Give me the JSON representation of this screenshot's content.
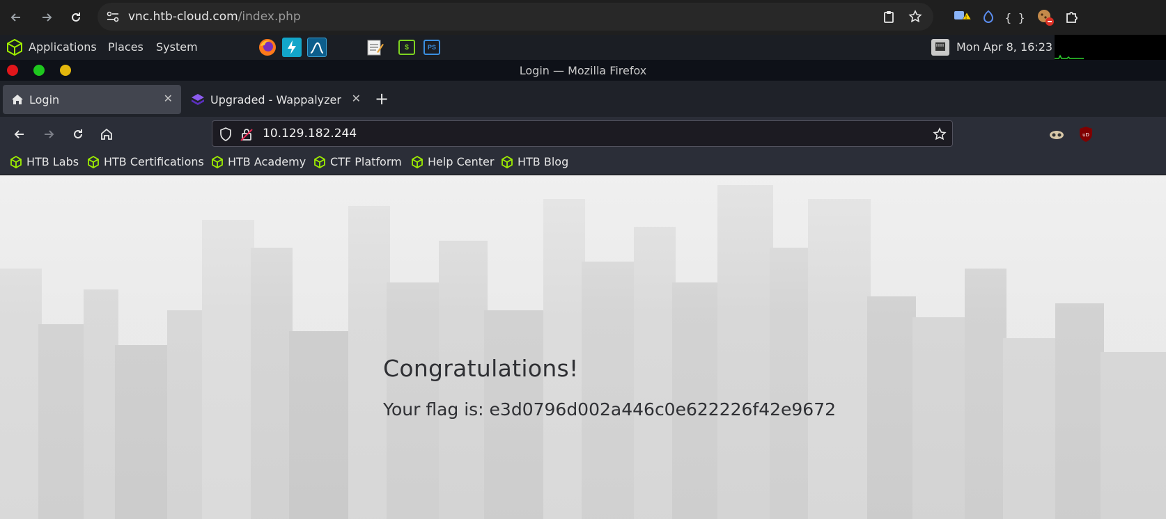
{
  "chrome": {
    "url_host": "vnc.htb-cloud.com",
    "url_path": "/index.php"
  },
  "desktop_panel": {
    "menus": [
      "Applications",
      "Places",
      "System"
    ],
    "launchers": [
      "firefox-icon",
      "zaproxy-icon",
      "wireshark-icon",
      "text-editor-icon",
      "terminal-icon",
      "powershell-icon"
    ],
    "terminal_label": "$",
    "powershell_label": "PS",
    "datetime": "Mon Apr  8, 16:23"
  },
  "firefox": {
    "window_title": "Login — Mozilla Firefox",
    "tabs": [
      {
        "label": "Login",
        "active": true
      },
      {
        "label": "Upgraded - Wappalyzer",
        "active": false
      }
    ],
    "new_tab_label": "+",
    "url": "10.129.182.244",
    "bookmarks": [
      "HTB Labs",
      "HTB Certifications",
      "HTB Academy",
      "CTF Platform",
      "Help Center",
      "HTB Blog"
    ]
  },
  "page": {
    "heading": "Congratulations!",
    "flag_text": "Your flag is: e3d0796d002a446c0e622226f42e9672"
  },
  "colors": {
    "htb_green": "#9fef00",
    "close_red": "#e0161b",
    "maximize_green": "#1ec71e",
    "minimize_yellow": "#e3b70c"
  }
}
